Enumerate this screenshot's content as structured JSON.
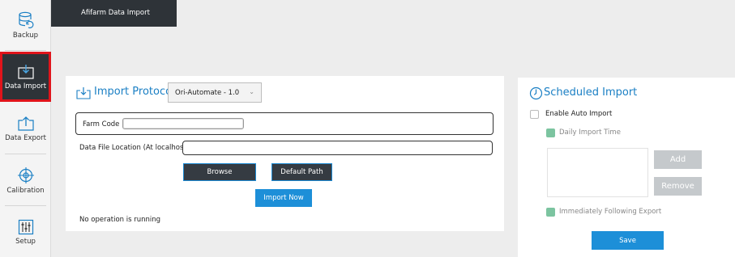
{
  "tab": {
    "title": "Afifarm Data Import"
  },
  "sidebar": {
    "items": [
      {
        "label": "Backup",
        "icon": "database-icon"
      },
      {
        "label": "Data Import",
        "icon": "import-icon",
        "active": true
      },
      {
        "label": "Data Export",
        "icon": "export-icon"
      },
      {
        "label": "Calibration",
        "icon": "crosshair-icon"
      },
      {
        "label": "Setup",
        "icon": "sliders-icon"
      }
    ]
  },
  "import_protocol": {
    "title": "Import Protocol",
    "protocol_value": "Ori-Automate - 1.0",
    "farm_code_label": "Farm Code",
    "farm_code_value": "",
    "file_location_label": "Data File Location (At localhost)",
    "file_location_value": "",
    "browse_label": "Browse",
    "default_path_label": "Default Path",
    "import_now_label": "Import Now",
    "status": "No operation is running"
  },
  "scheduled_import": {
    "title": "Scheduled Import",
    "enable_label": "Enable Auto Import",
    "daily_label": "Daily Import Time",
    "add_label": "Add",
    "remove_label": "Remove",
    "following_export_label": "Immediately Following Export",
    "save_label": "Save"
  },
  "colors": {
    "accent": "#1d8fd8",
    "dark": "#2e3338",
    "active_outline": "#e0141b",
    "checkbox_green": "#7cc4a0"
  }
}
